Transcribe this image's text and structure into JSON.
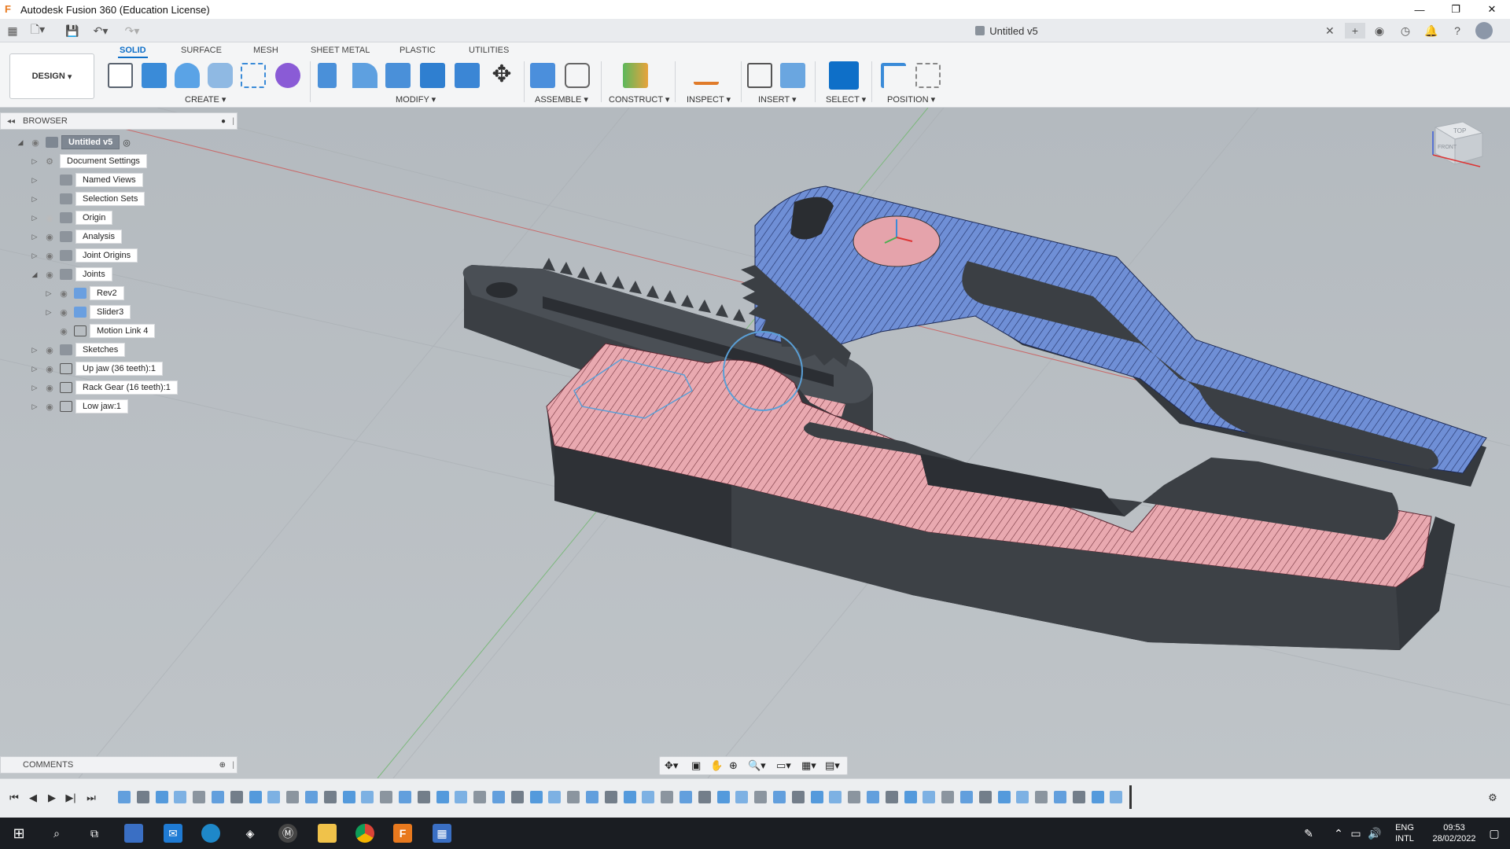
{
  "window": {
    "title": "Autodesk Fusion 360 (Education License)"
  },
  "document": {
    "title": "Untitled v5"
  },
  "ribbon": {
    "workspace": "DESIGN",
    "tabs": [
      "SOLID",
      "SURFACE",
      "MESH",
      "SHEET METAL",
      "PLASTIC",
      "UTILITIES"
    ],
    "active_tab": "SOLID",
    "groups": [
      "CREATE",
      "MODIFY",
      "ASSEMBLE",
      "CONSTRUCT",
      "INSPECT",
      "INSERT",
      "SELECT",
      "POSITION"
    ]
  },
  "browser": {
    "title": "BROWSER",
    "items": [
      {
        "label": "Untitled v5",
        "depth": 0
      },
      {
        "label": "Document Settings",
        "depth": 1
      },
      {
        "label": "Named Views",
        "depth": 1
      },
      {
        "label": "Selection Sets",
        "depth": 1
      },
      {
        "label": "Origin",
        "depth": 1
      },
      {
        "label": "Analysis",
        "depth": 1
      },
      {
        "label": "Joint Origins",
        "depth": 1
      },
      {
        "label": "Joints",
        "depth": 1
      },
      {
        "label": "Rev2",
        "depth": 2
      },
      {
        "label": "Slider3",
        "depth": 2
      },
      {
        "label": "Motion Link 4",
        "depth": 2
      },
      {
        "label": "Sketches",
        "depth": 1
      },
      {
        "label": "Up jaw (36 teeth):1",
        "depth": 1
      },
      {
        "label": "Rack Gear (16 teeth):1",
        "depth": 1
      },
      {
        "label": "Low jaw:1",
        "depth": 1
      }
    ]
  },
  "comments": {
    "title": "COMMENTS"
  },
  "viewcube": {
    "top": "TOP",
    "front": "FRONT"
  },
  "taskbar": {
    "lang": "ENG",
    "layout": "INTL",
    "time": "09:53",
    "date": "28/02/2022"
  },
  "colors": {
    "accent": "#0e6fc8",
    "up_jaw": "#6f8fd6",
    "low_jaw": "#e9a9b0",
    "body": "#3b3f44"
  }
}
